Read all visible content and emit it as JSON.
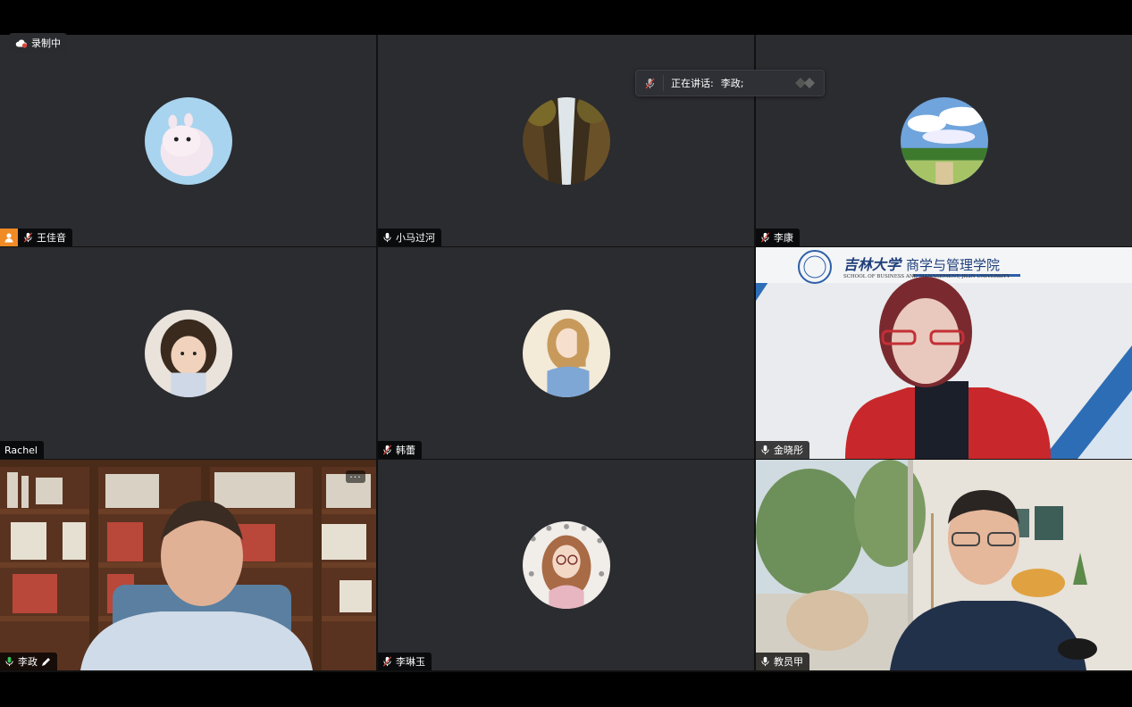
{
  "recording": {
    "label": "录制中"
  },
  "speaker_banner": {
    "label": "正在讲话:",
    "name": "李政;"
  },
  "participants": [
    {
      "name": "王佳音",
      "mic": "muted",
      "host": true
    },
    {
      "name": "小马过河",
      "mic": "on"
    },
    {
      "name": "李康",
      "mic": "muted"
    },
    {
      "name": "Rachel",
      "mic": "none"
    },
    {
      "name": "韩蕾",
      "mic": "muted"
    },
    {
      "name": "金晓彤",
      "mic": "on"
    },
    {
      "name": "李政",
      "mic": "active",
      "edit": true
    },
    {
      "name": "李琳玉",
      "mic": "muted"
    },
    {
      "name": "教员甲",
      "mic": "on"
    }
  ],
  "jlu_banner": {
    "cn_school": "吉林大学",
    "cn_college": "商学与管理学院",
    "en": "SCHOOL OF BUSINESS AND MANAGEMENT, JILIN UNIVERSITY"
  },
  "more_button": {
    "label": "···"
  },
  "colors": {
    "tile_bg": "#2b2c30",
    "active_border": "#35c759",
    "host_badge": "#f08a24",
    "muted_red": "#e0453a"
  }
}
